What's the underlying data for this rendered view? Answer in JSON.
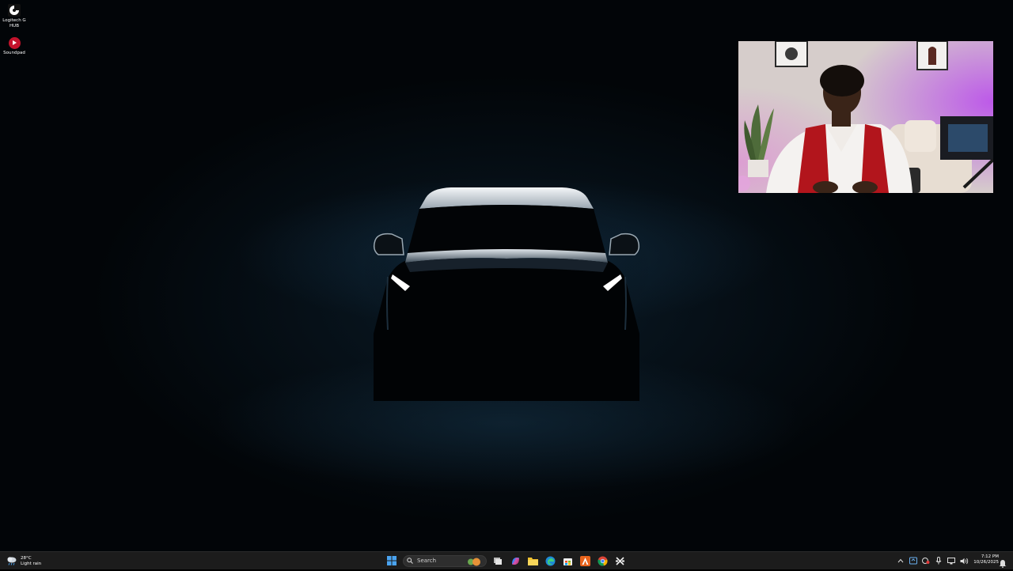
{
  "desktop": {
    "icons": [
      {
        "label": "Logitech G HUB",
        "icon": "logitech-g-hub-icon"
      },
      {
        "label": "Soundpad",
        "icon": "soundpad-icon"
      }
    ],
    "wallpaper": "dark-car-silhouette"
  },
  "webcam": {
    "description_icon": "webcam-feed"
  },
  "taskbar": {
    "weather": {
      "temp": "28°C",
      "condition": "Light rain"
    },
    "search": {
      "placeholder": "Search"
    },
    "pinned": [
      {
        "name": "start-button"
      },
      {
        "name": "task-view"
      },
      {
        "name": "copilot"
      },
      {
        "name": "file-explorer"
      },
      {
        "name": "edge"
      },
      {
        "name": "microsoft-store"
      },
      {
        "name": "office-app"
      },
      {
        "name": "chrome"
      },
      {
        "name": "capcut"
      }
    ],
    "clock": {
      "time": "7:12 PM",
      "date": "10/26/2025"
    }
  },
  "colors": {
    "taskbar_bg": "#1c1c1c",
    "accent_blue": "#4aa3f0",
    "soundpad_red": "#c4132c"
  }
}
